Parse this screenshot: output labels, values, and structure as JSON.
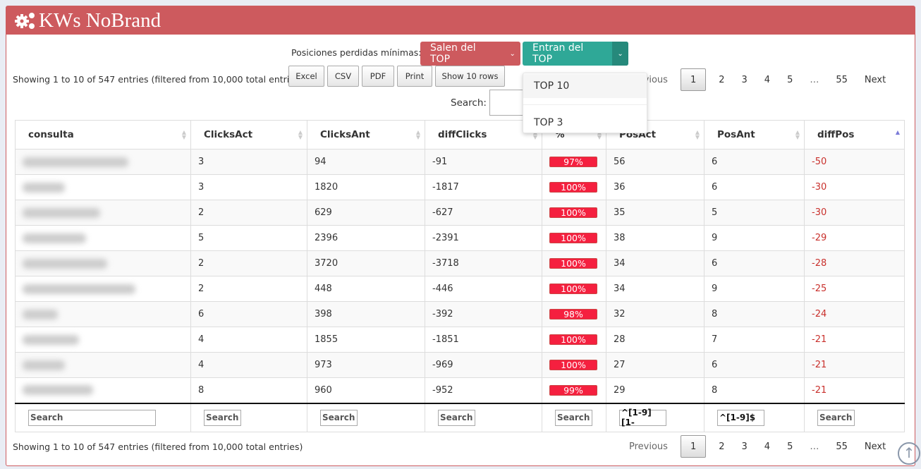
{
  "title": "KWs NoBrand",
  "controls": {
    "label": "Posiciones perdidas mínimas:",
    "salen": "Salen del TOP",
    "entran": "Entran del TOP",
    "menu": [
      "TOP 10",
      "TOP 3"
    ]
  },
  "info": "Showing 1 to 10 of 547 entries (filtered from 10,000 total entries)",
  "buttons": [
    "Excel",
    "CSV",
    "PDF",
    "Print",
    "Show 10 rows"
  ],
  "search_label": "Search:",
  "pager": {
    "prev": "Previous",
    "pages": [
      "1",
      "2",
      "3",
      "4",
      "5",
      "…",
      "55"
    ],
    "next": "Next"
  },
  "columns": [
    "consulta",
    "ClicksAct",
    "ClicksAnt",
    "diffClicks",
    "%",
    "PosAct",
    "PosAnt",
    "diffPos"
  ],
  "rows": [
    [
      "3",
      "94",
      "-91",
      "97%",
      "56",
      "6",
      "-50"
    ],
    [
      "3",
      "1820",
      "-1817",
      "100%",
      "36",
      "6",
      "-30"
    ],
    [
      "2",
      "629",
      "-627",
      "100%",
      "35",
      "5",
      "-30"
    ],
    [
      "5",
      "2396",
      "-2391",
      "100%",
      "38",
      "9",
      "-29"
    ],
    [
      "2",
      "3720",
      "-3718",
      "100%",
      "34",
      "6",
      "-28"
    ],
    [
      "2",
      "448",
      "-446",
      "100%",
      "34",
      "9",
      "-25"
    ],
    [
      "6",
      "398",
      "-392",
      "98%",
      "32",
      "8",
      "-24"
    ],
    [
      "4",
      "1855",
      "-1851",
      "100%",
      "28",
      "7",
      "-21"
    ],
    [
      "4",
      "973",
      "-969",
      "100%",
      "27",
      "6",
      "-21"
    ],
    [
      "8",
      "960",
      "-952",
      "99%",
      "29",
      "8",
      "-21"
    ]
  ],
  "filters": [
    "Search",
    "Search",
    "Search",
    "Search",
    "Search",
    "^[1-9][1-",
    "^[1-9]$",
    "Search"
  ],
  "colors": {
    "header": "#cd5a5e",
    "teal": "#2fa897",
    "bar": "#f5203f",
    "negative": "#c9302c"
  }
}
